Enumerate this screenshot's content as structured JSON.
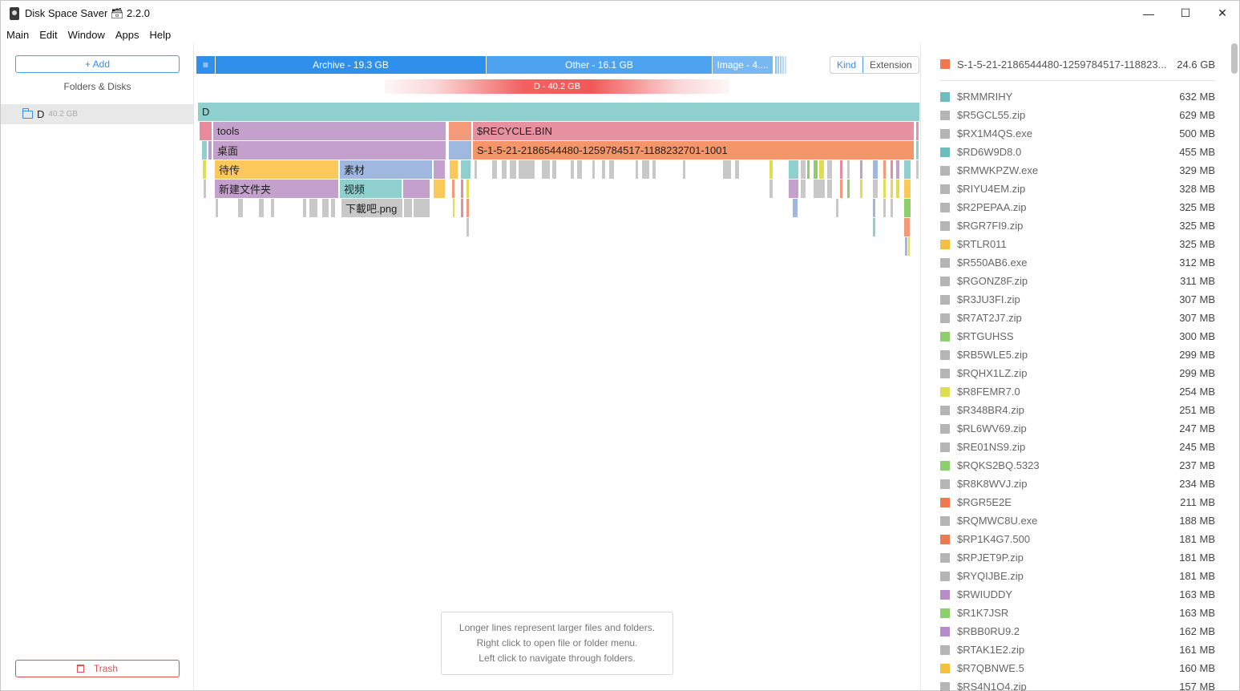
{
  "window": {
    "title": "Disk Space Saver 🗃 2.2.0",
    "minimize": "—",
    "maximize": "☐",
    "close": "✕"
  },
  "menu": [
    "Main",
    "Edit",
    "Window",
    "Apps",
    "Help"
  ],
  "sidebar": {
    "add_label": "+ Add",
    "section_label": "Folders & Disks",
    "disk": {
      "name": "D",
      "size": "40.2 GB"
    },
    "trash_label": "Trash"
  },
  "kind_bar": {
    "menu_glyph": "≡",
    "segments": [
      {
        "label": "Archive - 19.3 GB",
        "color": "#2f90ec"
      },
      {
        "label": "Other - 16.1 GB",
        "color": "#4da3ee"
      },
      {
        "label": "Image - 4....",
        "color": "#78b8f2"
      }
    ]
  },
  "view_toggle": {
    "kind": "Kind",
    "extension": "Extension"
  },
  "disk_bar": {
    "label": "D - 40.2 GB"
  },
  "tree": {
    "root": "D",
    "tools": "tools",
    "recycle": "$RECYCLE.BIN",
    "desktop": "桌面",
    "sid": "S-1-5-21-2186544480-1259784517-1188232701-1001",
    "daichuan": "待传",
    "sucai": "素材",
    "newfolder": "新建文件夹",
    "shipin": "视频",
    "xiazaiba": "下載吧.png"
  },
  "hint": [
    "Longer lines represent larger files and folders.",
    "Right click to open file or folder menu.",
    "Left click to navigate through folders."
  ],
  "right_panel": {
    "top": {
      "name": "S-1-5-21-2186544480-1259784517-118823...",
      "size": "24.6 GB",
      "color": "#f07850"
    },
    "files": [
      {
        "name": "$RMMRIHY",
        "size": "632 MB",
        "color": "#6cbdbd"
      },
      {
        "name": "$R5GCL55.zip",
        "size": "629 MB",
        "color": "#b5b5b5"
      },
      {
        "name": "$RX1M4QS.exe",
        "size": "500 MB",
        "color": "#b5b5b5"
      },
      {
        "name": "$RD6W9D8.0",
        "size": "455 MB",
        "color": "#6cbdbd"
      },
      {
        "name": "$RMWKPZW.exe",
        "size": "329 MB",
        "color": "#b5b5b5"
      },
      {
        "name": "$RIYU4EM.zip",
        "size": "328 MB",
        "color": "#b5b5b5"
      },
      {
        "name": "$R2PEPAA.zip",
        "size": "325 MB",
        "color": "#b5b5b5"
      },
      {
        "name": "$RGR7FI9.zip",
        "size": "325 MB",
        "color": "#b5b5b5"
      },
      {
        "name": "$RTLR011",
        "size": "325 MB",
        "color": "#f5c040"
      },
      {
        "name": "$R550AB6.exe",
        "size": "312 MB",
        "color": "#b5b5b5"
      },
      {
        "name": "$RGONZ8F.zip",
        "size": "311 MB",
        "color": "#b5b5b5"
      },
      {
        "name": "$R3JU3FI.zip",
        "size": "307 MB",
        "color": "#b5b5b5"
      },
      {
        "name": "$R7AT2J7.zip",
        "size": "307 MB",
        "color": "#b5b5b5"
      },
      {
        "name": "$RTGUHSS",
        "size": "300 MB",
        "color": "#8ccf6c"
      },
      {
        "name": "$RB5WLE5.zip",
        "size": "299 MB",
        "color": "#b5b5b5"
      },
      {
        "name": "$RQHX1LZ.zip",
        "size": "299 MB",
        "color": "#b5b5b5"
      },
      {
        "name": "$R8FEMR7.0",
        "size": "254 MB",
        "color": "#dede50"
      },
      {
        "name": "$R348BR4.zip",
        "size": "251 MB",
        "color": "#b5b5b5"
      },
      {
        "name": "$RL6WV69.zip",
        "size": "247 MB",
        "color": "#b5b5b5"
      },
      {
        "name": "$RE01NS9.zip",
        "size": "245 MB",
        "color": "#b5b5b5"
      },
      {
        "name": "$RQKS2BQ.5323",
        "size": "237 MB",
        "color": "#8ccf6c"
      },
      {
        "name": "$R8K8WVJ.zip",
        "size": "234 MB",
        "color": "#b5b5b5"
      },
      {
        "name": "$RGR5E2E",
        "size": "211 MB",
        "color": "#f07850"
      },
      {
        "name": "$RQMWC8U.exe",
        "size": "188 MB",
        "color": "#b5b5b5"
      },
      {
        "name": "$RP1K4G7.500",
        "size": "181 MB",
        "color": "#f07850"
      },
      {
        "name": "$RPJET9P.zip",
        "size": "181 MB",
        "color": "#b5b5b5"
      },
      {
        "name": "$RYQIJBE.zip",
        "size": "181 MB",
        "color": "#b5b5b5"
      },
      {
        "name": "$RWIUDDY",
        "size": "163 MB",
        "color": "#b88cc8"
      },
      {
        "name": "$R1K7JSR",
        "size": "163 MB",
        "color": "#8ccf6c"
      },
      {
        "name": "$RBB0RU9.2",
        "size": "162 MB",
        "color": "#b88cc8"
      },
      {
        "name": "$RTAK1E2.zip",
        "size": "161 MB",
        "color": "#b5b5b5"
      },
      {
        "name": "$R7QBNWE.5",
        "size": "160 MB",
        "color": "#f5c040"
      },
      {
        "name": "$RS4N1O4.zip",
        "size": "157 MB",
        "color": "#b5b5b5"
      }
    ]
  }
}
